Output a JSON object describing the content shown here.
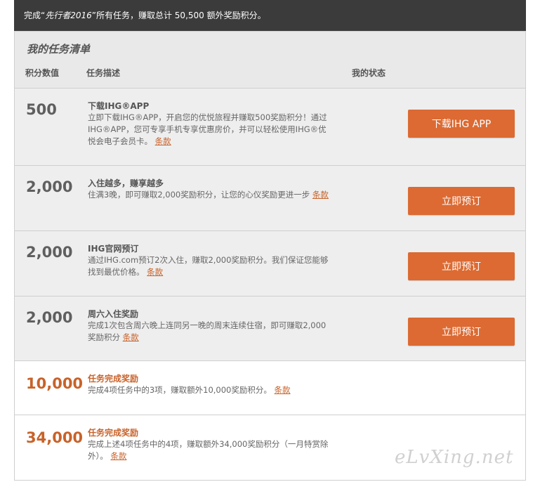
{
  "banner": {
    "prefix": "完成“",
    "emphasis": "先行者2016",
    "suffix": "”所有任务，赚取总计 50,500 额外奖励积分。"
  },
  "list": {
    "title": "我的任务清单",
    "columns": {
      "points": "积分数值",
      "description": "任务描述",
      "status": "我的状态"
    }
  },
  "tasks": [
    {
      "points": "500",
      "title": "下载IHG®APP",
      "description": "立即下载IHG®APP，开启您的优悦旅程并赚取500奖励积分！通过IHG®APP，您可专享手机专享优惠房价，并可以轻松使用IHG®优悦会电子会员卡。",
      "terms": "条款",
      "button": "下载IHG APP"
    },
    {
      "points": "2,000",
      "title": "入住越多，赚享越多",
      "description": "住满3晚，即可赚取2,000奖励积分，让您的心仪奖励更进一步",
      "terms": "条款",
      "button": "立即预订"
    },
    {
      "points": "2,000",
      "title": "IHG官网预订",
      "description": "通过IHG.com预订2次入住，赚取2,000奖励积分。我们保证您能够找到最优价格。",
      "terms": "条款",
      "button": "立即预订"
    },
    {
      "points": "2,000",
      "title": "周六入住奖励",
      "description": "完成1次包含周六晚上连同另一晚的周末连续住宿，即可赚取2,000奖励积分",
      "terms": "条款",
      "button": "立即预订"
    }
  ],
  "rewards": [
    {
      "points": "10,000",
      "title": "任务完成奖励",
      "description": "完成4项任务中的3项，赚取额外10,000奖励积分。",
      "terms": "条款"
    },
    {
      "points": "34,000",
      "title": "任务完成奖励",
      "description": "完成上述4项任务中的4项，赚取额外34,000奖励积分（一月特赏除外）。",
      "terms": "条款"
    }
  ],
  "watermark": "eLvXing.net",
  "colors": {
    "accent": "#dc6a32",
    "banner_bg": "#3b3b3b",
    "row_bg": "#eeeeee"
  }
}
